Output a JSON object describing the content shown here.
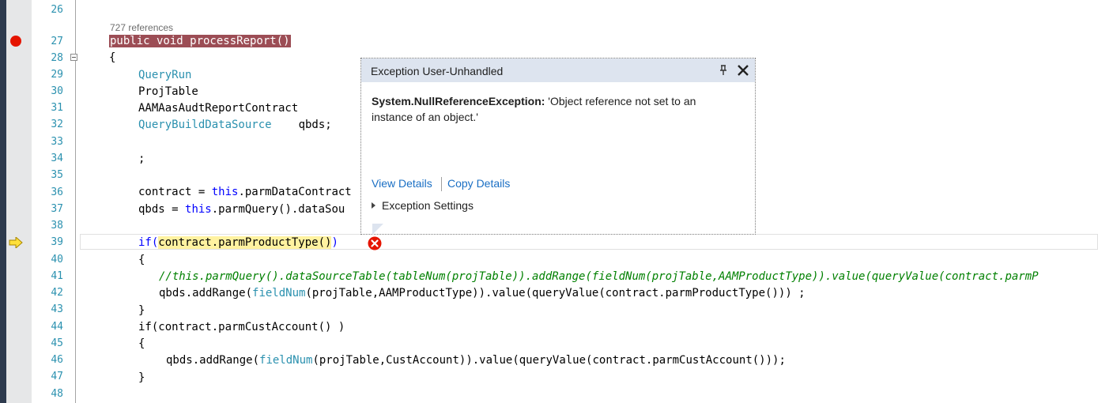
{
  "editor": {
    "reference_lens": "727 references",
    "line_numbers": [
      "26",
      "27",
      "28",
      "29",
      "30",
      "31",
      "32",
      "33",
      "34",
      "35",
      "36",
      "37",
      "38",
      "39",
      "40",
      "41",
      "42",
      "43",
      "44",
      "45",
      "46",
      "47",
      "48"
    ],
    "lines": {
      "l27": "public void processReport()",
      "l28": "{",
      "l29": "QueryRun",
      "l30": "ProjTable",
      "l31": "AAMAasAudtReportContract",
      "l32a": "QueryBuildDataSource",
      "l32b": "qbds;",
      "l34": ";",
      "l36a": "contract = ",
      "l36b": "this",
      "l36c": ".parmDataContract",
      "l37a": "qbds = ",
      "l37b": "this",
      "l37c": ".parmQuery().dataSou",
      "l39a": "if(",
      "l39b": "contract.parmProductType()",
      "l39c": ")",
      "l40": "{",
      "l41": "//this.parmQuery().dataSourceTable(tableNum(projTable)).addRange(fieldNum(projTable,AAMProductType)).value(queryValue(contract.parmP",
      "l42a": "qbds.addRange(",
      "l42b": "fieldNum",
      "l42c": "(projTable,AAMProductType)).value(queryValue(contract.parmProductType())) ;",
      "l43": "}",
      "l44": "if(contract.parmCustAccount() )",
      "l45": "{",
      "l46a": "qbds.addRange(",
      "l46b": "fieldNum",
      "l46c": "(projTable,CustAccount)).value(queryValue(contract.parmCustAccount()));",
      "l47": "}"
    }
  },
  "exception_popup": {
    "title": "Exception User-Unhandled",
    "exception_type": "System.NullReferenceException:",
    "message": "'Object reference not set to an instance of an object.'",
    "view_details": "View Details",
    "copy_details": "Copy Details",
    "exception_settings": "Exception Settings"
  },
  "colors": {
    "breakpoint": "#e51400",
    "keyword": "#0000ff",
    "type": "#2b91af",
    "comment": "#008000",
    "link": "#1a6fc4",
    "popup_header": "#dde4ef"
  }
}
